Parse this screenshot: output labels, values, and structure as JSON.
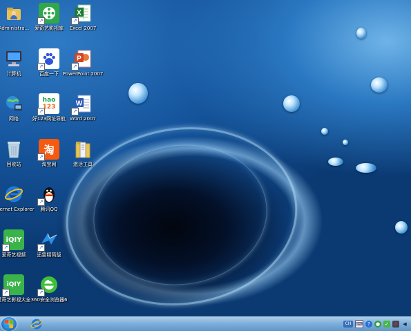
{
  "desktop": {
    "icons": [
      {
        "id": "admin",
        "label": "Administra...",
        "icon": "user-folder-icon"
      },
      {
        "id": "iqiyi-lib",
        "label": "爱奇艺影视库",
        "icon": "film-reel-icon"
      },
      {
        "id": "excel",
        "label": "Excel 2007",
        "icon": "excel-icon"
      },
      {
        "id": "computer",
        "label": "计算机",
        "icon": "computer-icon"
      },
      {
        "id": "baidu",
        "label": "百度一下",
        "icon": "baidu-paw-icon"
      },
      {
        "id": "powerpoint",
        "label": "PowerPoint 2007",
        "icon": "powerpoint-icon"
      },
      {
        "id": "network",
        "label": "网络",
        "icon": "network-globe-icon"
      },
      {
        "id": "hao123",
        "label": "好123网址导航",
        "icon": "hao123-icon"
      },
      {
        "id": "word",
        "label": "Word 2007",
        "icon": "word-icon"
      },
      {
        "id": "recycle",
        "label": "回收站",
        "icon": "recycle-bin-icon"
      },
      {
        "id": "taobao",
        "label": "淘宝网",
        "icon": "taobao-icon"
      },
      {
        "id": "activate",
        "label": "激活工具",
        "icon": "activation-tool-icon"
      },
      {
        "id": "ie",
        "label": "Internet Explorer",
        "icon": "internet-explorer-icon"
      },
      {
        "id": "qq",
        "label": "腾讯QQ",
        "icon": "qq-penguin-icon"
      },
      {
        "id": "iqiyi",
        "label": "爱奇艺视频",
        "icon": "iqiyi-icon"
      },
      {
        "id": "xunlei",
        "label": "迅雷精简版",
        "icon": "xunlei-bird-icon"
      },
      {
        "id": "iqiyi-hd",
        "label": "爱奇艺影视大全",
        "icon": "iqiyi-hd-icon"
      },
      {
        "id": "browser360",
        "label": "360安全浏览器6",
        "icon": "browser-360-icon"
      }
    ]
  },
  "taskbar": {
    "start": "start-orb-icon",
    "pinned": [
      "internet-explorer-icon"
    ],
    "tray": [
      "ch-input-icon",
      "keyboard-icon",
      "help-icon",
      "security-icon",
      "shield-360-icon",
      "network-tray-icon",
      "volume-icon"
    ],
    "tray_labels": {
      "input": "CH"
    }
  },
  "colors": {
    "desktop_blue": "#0d3f7c",
    "taskbar_top": "#a9cdea",
    "taskbar_bottom": "#5f95c8"
  }
}
